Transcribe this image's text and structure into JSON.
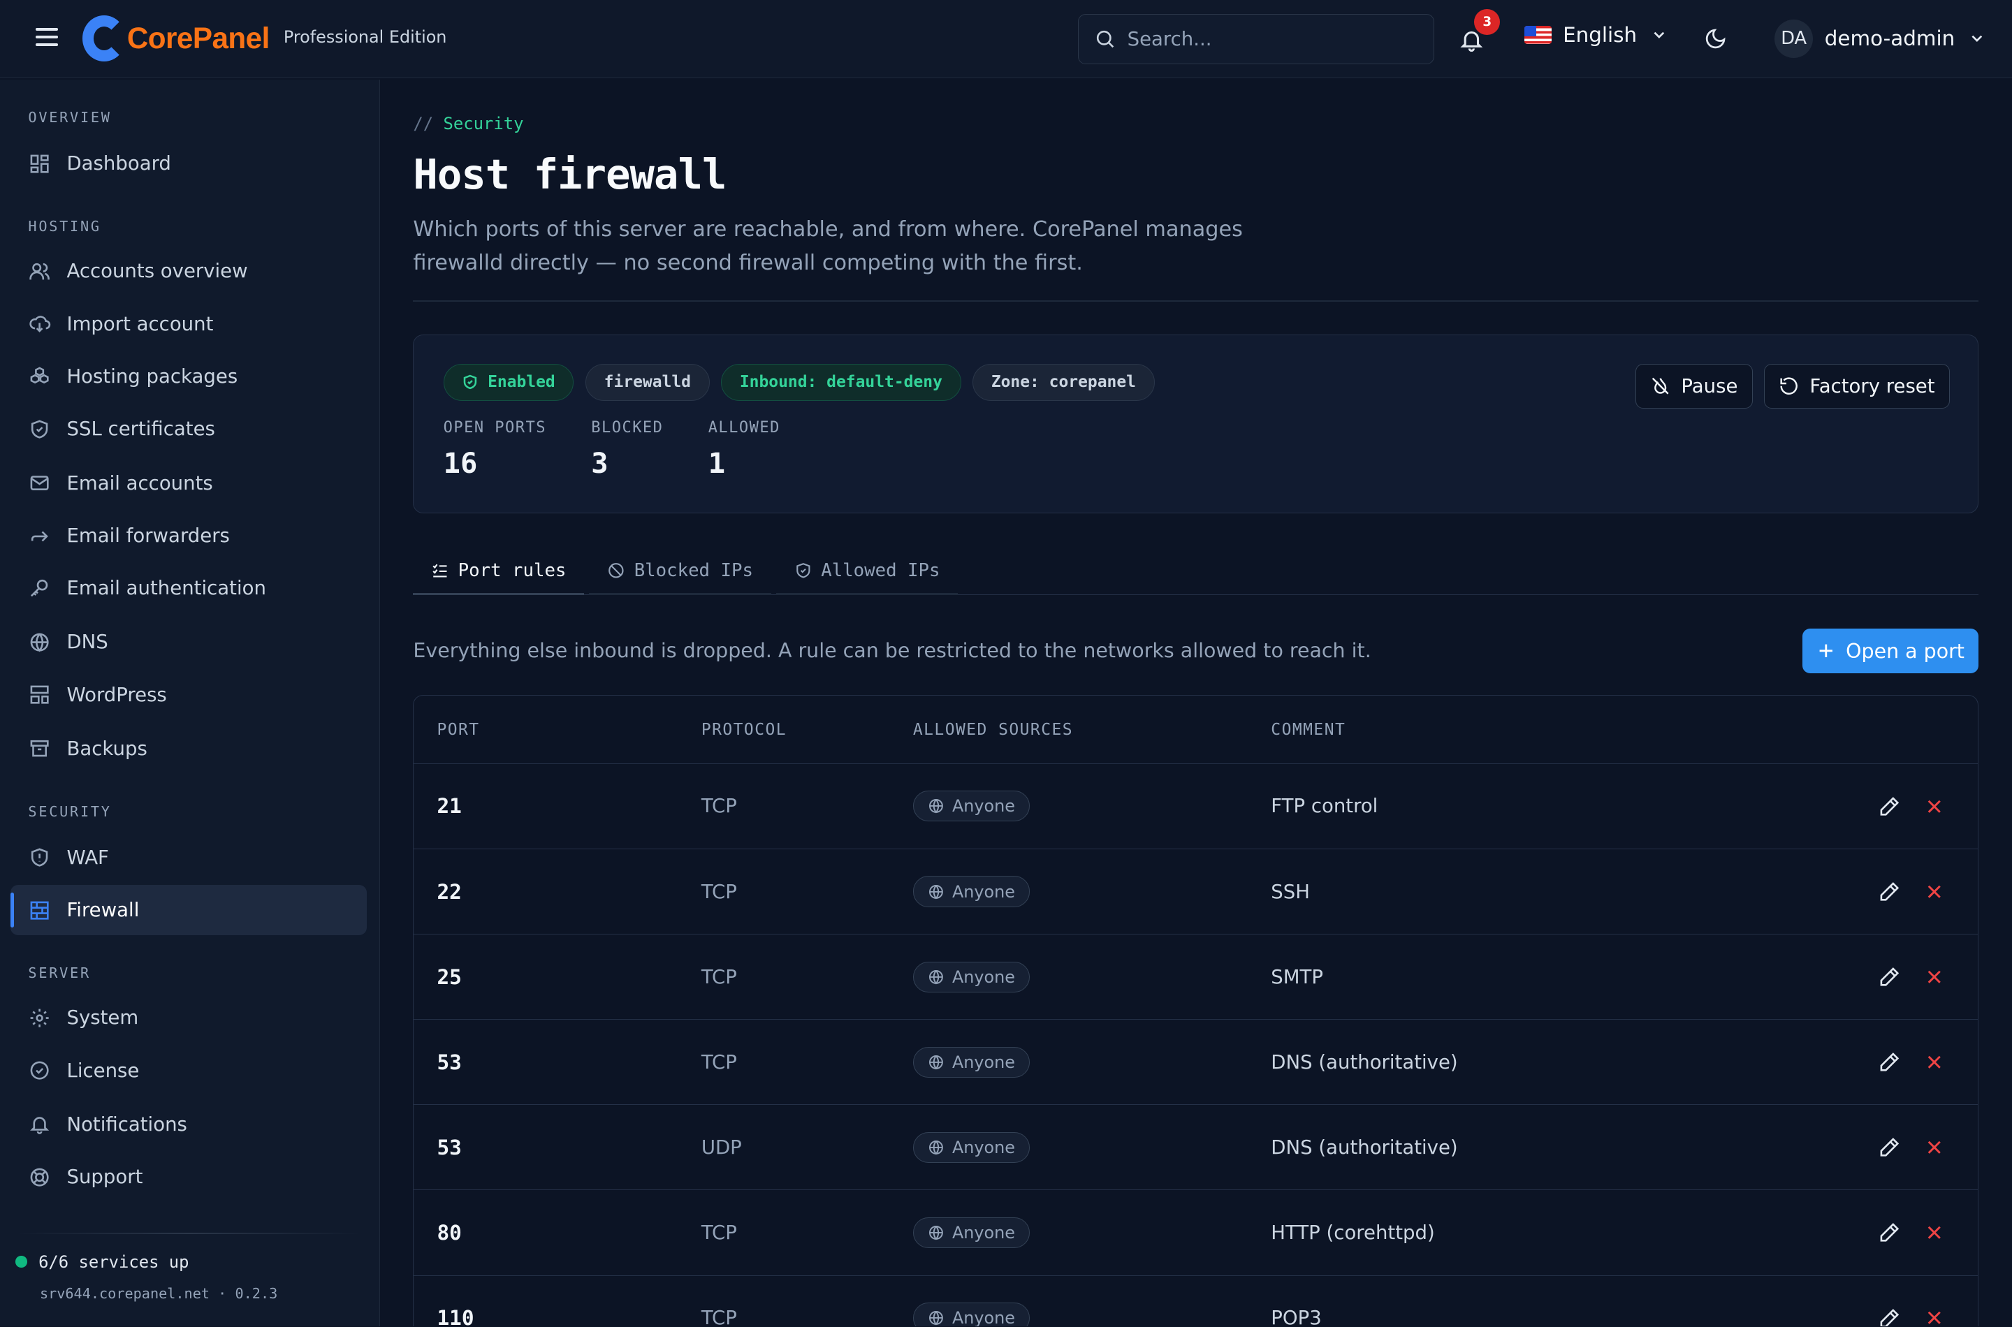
{
  "header": {
    "brand": "CorePanel",
    "edition": "Professional Edition",
    "search_placeholder": "Search...",
    "notification_count": "3",
    "language": "English",
    "user_initials": "DA",
    "username": "demo-admin"
  },
  "sidebar": {
    "sections": {
      "overview": "OVERVIEW",
      "hosting": "HOSTING",
      "security": "SECURITY",
      "server": "SERVER"
    },
    "items": {
      "dashboard": "Dashboard",
      "accounts": "Accounts overview",
      "import": "Import account",
      "packages": "Hosting packages",
      "ssl": "SSL certificates",
      "email_accounts": "Email accounts",
      "email_forwarders": "Email forwarders",
      "email_auth": "Email authentication",
      "dns": "DNS",
      "wordpress": "WordPress",
      "backups": "Backups",
      "waf": "WAF",
      "firewall": "Firewall",
      "system": "System",
      "license": "License",
      "notifications": "Notifications",
      "support": "Support"
    },
    "status": "6/6 services up",
    "server": "srv644.corepanel.net · 0.2.3",
    "status_color": "#10b981"
  },
  "page": {
    "breadcrumb_sep": "//",
    "breadcrumb": "Security",
    "title": "Host firewall",
    "description": "Which ports of this server are reachable, and from where. CorePanel manages firewalld directly — no second firewall competing with the first."
  },
  "summary": {
    "pills": {
      "enabled": "Enabled",
      "engine": "firewalld",
      "inbound": "Inbound: default-deny",
      "zone": "Zone: corepanel"
    },
    "stats": [
      {
        "label": "OPEN PORTS",
        "value": "16"
      },
      {
        "label": "BLOCKED",
        "value": "3"
      },
      {
        "label": "ALLOWED",
        "value": "1"
      }
    ],
    "pause_label": "Pause",
    "reset_label": "Factory reset"
  },
  "tabs": {
    "port_rules": "Port rules",
    "blocked_ips": "Blocked IPs",
    "allowed_ips": "Allowed IPs"
  },
  "rules": {
    "info": "Everything else inbound is dropped. A rule can be restricted to the networks allowed to reach it.",
    "open_port_label": "Open a port",
    "columns": [
      "PORT",
      "PROTOCOL",
      "ALLOWED SOURCES",
      "COMMENT"
    ],
    "rows": [
      {
        "port": "21",
        "protocol": "TCP",
        "source": "Anyone",
        "comment": "FTP control"
      },
      {
        "port": "22",
        "protocol": "TCP",
        "source": "Anyone",
        "comment": "SSH"
      },
      {
        "port": "25",
        "protocol": "TCP",
        "source": "Anyone",
        "comment": "SMTP"
      },
      {
        "port": "53",
        "protocol": "TCP",
        "source": "Anyone",
        "comment": "DNS (authoritative)"
      },
      {
        "port": "53",
        "protocol": "UDP",
        "source": "Anyone",
        "comment": "DNS (authoritative)"
      },
      {
        "port": "80",
        "protocol": "TCP",
        "source": "Anyone",
        "comment": "HTTP (corehttpd)"
      },
      {
        "port": "110",
        "protocol": "TCP",
        "source": "Anyone",
        "comment": "POP3"
      }
    ]
  },
  "colors": {
    "accent": "#2e8ff0",
    "success": "#34d399",
    "danger": "#ef4444",
    "brand_orange": "#f97316"
  }
}
